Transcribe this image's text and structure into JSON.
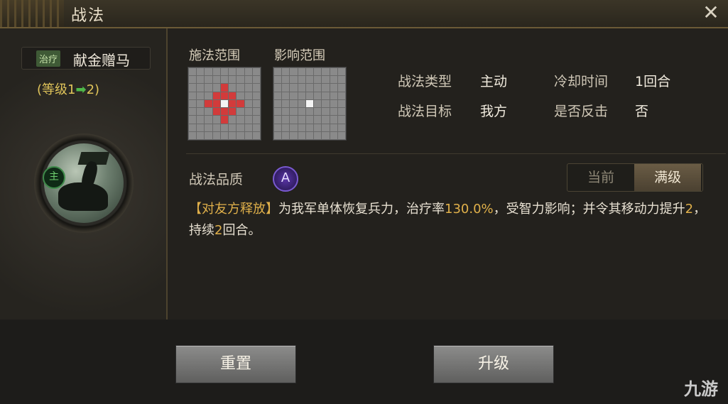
{
  "header": {
    "title": "战法",
    "close_icon": "✕"
  },
  "skill": {
    "tag": "治疗",
    "name": "献金赠马",
    "level_prefix": "(等级1",
    "level_arrow": "➡",
    "level_suffix": "2)",
    "main_badge": "主"
  },
  "ranges": {
    "cast_label": "施法范围",
    "effect_label": "影响范围"
  },
  "info": {
    "type_label": "战法类型",
    "type_value": "主动",
    "cooldown_label": "冷却时间",
    "cooldown_value": "1回合",
    "target_label": "战法目标",
    "target_value": "我方",
    "counter_label": "是否反击",
    "counter_value": "否"
  },
  "quality": {
    "label": "战法品质",
    "grade": "A"
  },
  "toggle": {
    "current": "当前",
    "max": "满级",
    "selected": "满级"
  },
  "description": {
    "tag": "【对友方释放】",
    "p1": "为我军单体恢复兵力，治疗率",
    "n1": "130.0%",
    "p2": "，受智力影响；并令其移动力提升",
    "n2": "2",
    "p3": "，持续",
    "n3": "2",
    "p4": "回合。"
  },
  "buttons": {
    "reset": "重置",
    "upgrade": "升级"
  },
  "watermark": "九游"
}
